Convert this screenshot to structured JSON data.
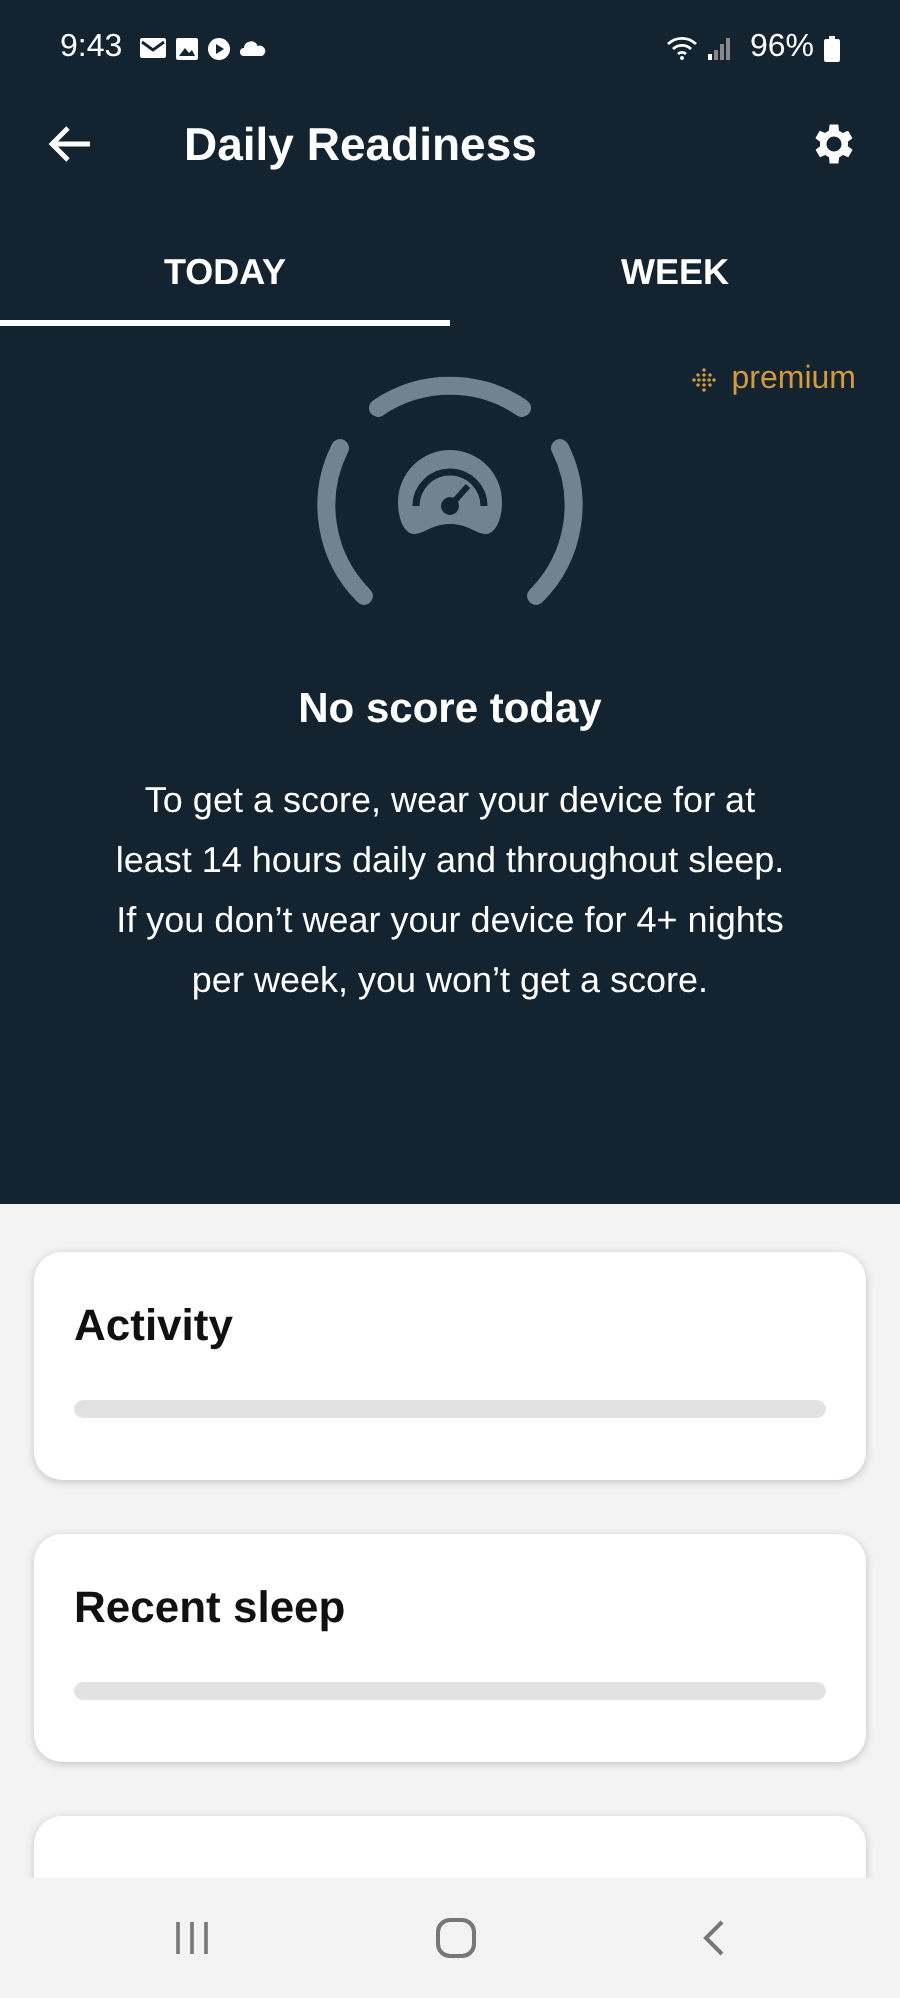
{
  "status_bar": {
    "time": "9:43",
    "battery": "96%"
  },
  "header": {
    "title": "Daily Readiness"
  },
  "tabs": [
    {
      "label": "TODAY",
      "selected": true
    },
    {
      "label": "WEEK",
      "selected": false
    }
  ],
  "badge": {
    "label": "premium"
  },
  "score": {
    "title": "No score today",
    "message": "To get a score, wear your device for at least 14 hours daily and throughout sleep. If you don’t wear your device for 4+ nights per week, you won’t get a score."
  },
  "cards": [
    {
      "kind": "metric",
      "title": "Activity"
    },
    {
      "kind": "metric",
      "title": "Recent sleep"
    },
    {
      "kind": "cut_off"
    }
  ]
}
